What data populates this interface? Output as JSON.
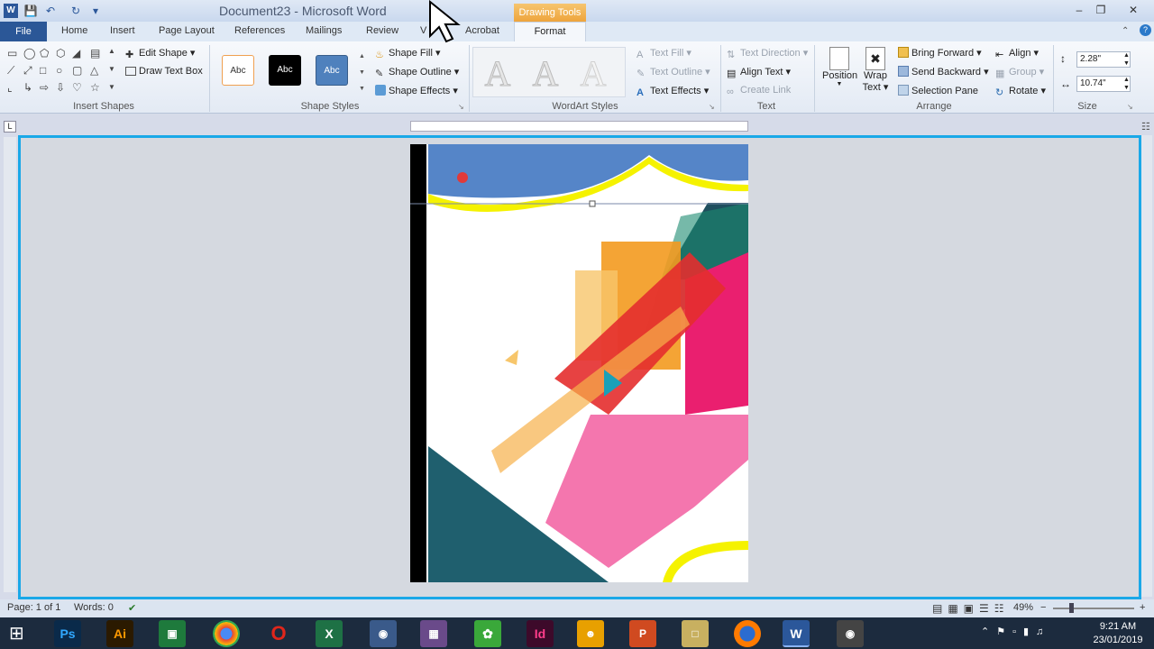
{
  "titlebar": {
    "title": "Document23 - Microsoft Word",
    "context_tab": "Drawing Tools"
  },
  "tabs": {
    "file": "File",
    "home": "Home",
    "insert": "Insert",
    "page_layout": "Page Layout",
    "references": "References",
    "mailings": "Mailings",
    "review": "Review",
    "view": "V",
    "acrobat": "Acrobat",
    "format": "Format"
  },
  "insert_shapes": {
    "edit_shape": "Edit Shape",
    "draw_text_box": "Draw Text Box",
    "label": "Insert Shapes"
  },
  "shape_styles": {
    "abc1": "Abc",
    "abc2": "Abc",
    "abc3": "Abc",
    "fill": "Shape Fill",
    "outline": "Shape Outline",
    "effects": "Shape Effects",
    "label": "Shape Styles"
  },
  "wordart": {
    "glyph": "A",
    "text_fill": "Text Fill",
    "text_outline": "Text Outline",
    "text_effects": "Text Effects",
    "label": "WordArt Styles"
  },
  "text_group": {
    "direction": "Text Direction",
    "align": "Align Text",
    "link": "Create Link",
    "label": "Text"
  },
  "arrange": {
    "position": "Position",
    "wrap_1": "Wrap",
    "wrap_2": "Text",
    "bring_forward": "Bring Forward",
    "send_backward": "Send Backward",
    "selection_pane": "Selection Pane",
    "align": "Align",
    "group": "Group",
    "rotate": "Rotate",
    "label": "Arrange"
  },
  "size": {
    "height": "2.28\"",
    "width": "10.74\"",
    "label": "Size"
  },
  "status": {
    "page": "Page: 1 of 1",
    "words": "Words: 0",
    "zoom": "49%"
  },
  "taskbar": {
    "time": "9:21 AM",
    "date": "23/01/2019",
    "apps": [
      "Ps",
      "Ai",
      "X",
      "Id",
      "W"
    ]
  },
  "colors": {
    "accent": "#2b5797",
    "selection": "#1aa8e8",
    "drawing_tools": "#f0ad4e"
  }
}
